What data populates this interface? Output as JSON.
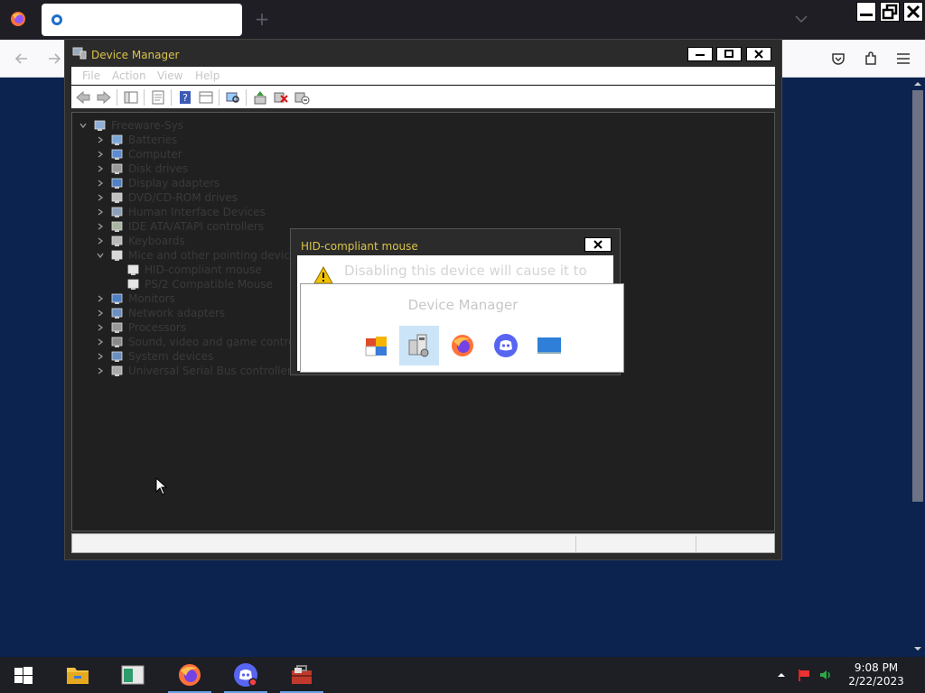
{
  "device_manager": {
    "title": "Device Manager",
    "menu": [
      "File",
      "Action",
      "View",
      "Help"
    ],
    "root": "Freeware-Sys",
    "categories": [
      {
        "label": "Batteries"
      },
      {
        "label": "Computer"
      },
      {
        "label": "Disk drives"
      },
      {
        "label": "Display adapters"
      },
      {
        "label": "DVD/CD-ROM drives"
      },
      {
        "label": "Human Interface Devices"
      },
      {
        "label": "IDE ATA/ATAPI controllers"
      },
      {
        "label": "Keyboards"
      },
      {
        "label": "Mice and other pointing devices",
        "expanded": true,
        "children": [
          "HID-compliant mouse",
          "PS/2 Compatible Mouse"
        ]
      },
      {
        "label": "Monitors"
      },
      {
        "label": "Network adapters"
      },
      {
        "label": "Processors"
      },
      {
        "label": "Sound, video and game controllers"
      },
      {
        "label": "System devices"
      },
      {
        "label": "Universal Serial Bus controllers"
      }
    ]
  },
  "hid_dialog": {
    "title": "HID-compliant mouse",
    "message": "Disabling this device will cause it to"
  },
  "switcher": {
    "title": "Device Manager",
    "apps": [
      "control-panel-icon",
      "device-manager-icon",
      "firefox-icon",
      "discord-icon",
      "desktop-icon"
    ],
    "selected_index": 1
  },
  "taskbar": {
    "apps": [
      "file-explorer",
      "app-window",
      "firefox",
      "discord",
      "device-manager"
    ],
    "time": "9:08 PM",
    "date": "2/22/2023"
  },
  "colors": {
    "desktop": "#0c2350",
    "title_text": "#d9c34a",
    "taskbar": "#1d1f24",
    "accent": "#6aa2e6"
  }
}
